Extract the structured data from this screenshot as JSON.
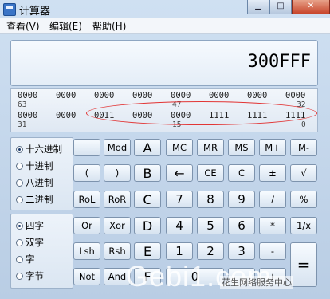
{
  "window": {
    "title": "计算器"
  },
  "menu": [
    "查看(V)",
    "编辑(E)",
    "帮助(H)"
  ],
  "display": {
    "value": "300FFF"
  },
  "bits": {
    "row1": [
      "0000",
      "0000",
      "0000",
      "0000",
      "0000",
      "0000",
      "0000",
      "0000"
    ],
    "row1_positions": [
      "63",
      "47",
      "32"
    ],
    "row2": [
      "0000",
      "0000",
      "0011",
      "0000",
      "0000",
      "1111",
      "1111",
      "1111"
    ],
    "row2_positions": [
      "31",
      "15",
      "0"
    ]
  },
  "radix": {
    "options": [
      "十六进制",
      "十进制",
      "八进制",
      "二进制"
    ],
    "selected": 0
  },
  "word": {
    "options": [
      "四字",
      "双字",
      "字",
      "字节"
    ],
    "selected": 0
  },
  "keys": {
    "r0": [
      "",
      "Mod",
      "A",
      "MC",
      "MR",
      "MS",
      "M+",
      "M-"
    ],
    "r1": [
      "(",
      ")",
      "B",
      "←",
      "CE",
      "C",
      "±",
      "√"
    ],
    "r2": [
      "RoL",
      "RoR",
      "C",
      "7",
      "8",
      "9",
      "/",
      "%"
    ],
    "r3": [
      "Or",
      "Xor",
      "D",
      "4",
      "5",
      "6",
      "*",
      "1/x"
    ],
    "r4": [
      "Lsh",
      "Rsh",
      "E",
      "1",
      "2",
      "3",
      "-",
      "="
    ],
    "r5": [
      "Not",
      "And",
      "F",
      "0",
      "",
      ".",
      "+"
    ]
  },
  "watermark": {
    "text": "Gebi1.com",
    "caption": "花生网络服务中心"
  }
}
